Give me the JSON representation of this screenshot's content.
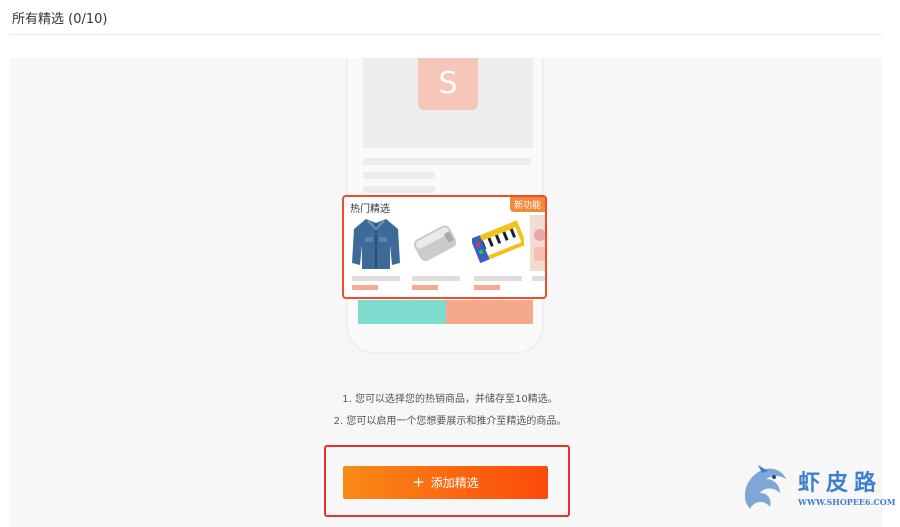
{
  "header": {
    "title": "所有精选 (0/10)"
  },
  "mockup": {
    "logo_letter": "S",
    "section_title": "热门精选",
    "new_badge": "新功能",
    "products": [
      "jacket-icon",
      "power-bank-icon",
      "piano-mat-icon",
      "partial-product-icon"
    ]
  },
  "hints": [
    "1. 您可以选择您的热销商品，并储存至10精选。",
    "2. 您可以启用一个您想要展示和推介至精选的商品。"
  ],
  "actions": {
    "add_label": "添加精选",
    "plus": "+"
  },
  "watermark": {
    "text": "虾皮路",
    "url": "WWW.SHOPEE6.COM"
  },
  "colors": {
    "accent": "#ee4d2d",
    "button_start": "#f98a16",
    "button_end": "#fc4a0b",
    "highlight": "#e5322d"
  }
}
